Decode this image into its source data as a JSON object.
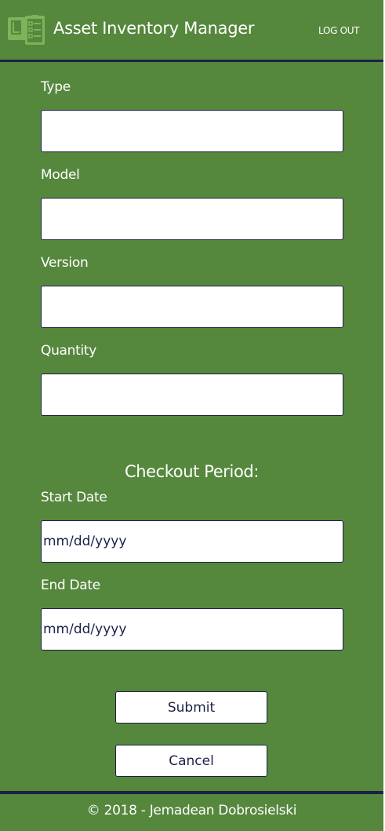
{
  "header": {
    "title": "Asset Inventory Manager",
    "logout_label": "LOG OUT",
    "logo_icon": "inventory-checklist-icon"
  },
  "form": {
    "fields": [
      {
        "label": "Type",
        "value": "",
        "placeholder": ""
      },
      {
        "label": "Model",
        "value": "",
        "placeholder": ""
      },
      {
        "label": "Version",
        "value": "",
        "placeholder": ""
      },
      {
        "label": "Quantity",
        "value": "",
        "placeholder": ""
      }
    ],
    "checkout_heading": "Checkout Period:",
    "start_date": {
      "label": "Start Date",
      "value": "",
      "placeholder": "mm/dd/yyyy"
    },
    "end_date": {
      "label": "End Date",
      "value": "",
      "placeholder": "mm/dd/yyyy"
    },
    "submit_label": "Submit",
    "cancel_label": "Cancel"
  },
  "footer": {
    "text": "© 2018 - Jemadean Dobrosielski"
  },
  "colors": {
    "background": "#55873d",
    "accent_dark": "#1b2147",
    "logo": "#7fb35a",
    "text": "#ffffff"
  }
}
